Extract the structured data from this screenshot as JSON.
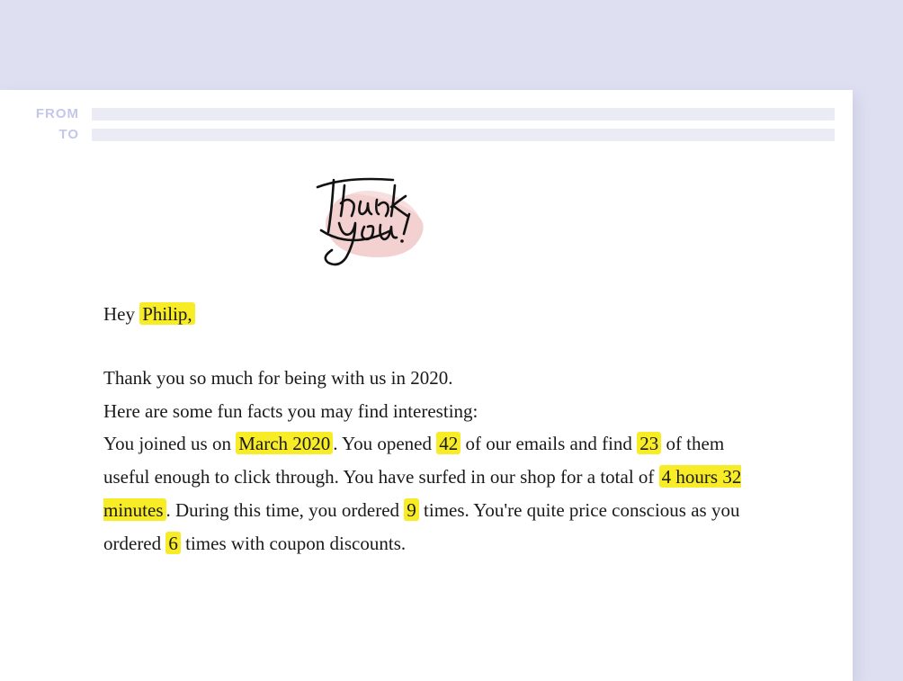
{
  "header": {
    "from_label": "FROM",
    "to_label": "TO"
  },
  "logo": {
    "name": "Thank You!"
  },
  "email": {
    "greeting_prefix": "Hey ",
    "recipient_name": "Philip,",
    "line1": "Thank you so much for being with us in 2020.",
    "line2": "Here are some fun facts you may find interesting:",
    "seg_you_joined": "You joined us on ",
    "hl_join_date": "March 2020",
    "seg_you_opened": ". You opened ",
    "hl_open_count": "42",
    "seg_of_emails_and_find": " of our emails and find ",
    "hl_useful_count": "23",
    "seg_useful_click": " of them useful enough to click through. You have surfed in our shop for a total of ",
    "hl_duration": "4 hours 32 minutes",
    "seg_during_time_ordered": ". During this time, you ordered ",
    "hl_order_count": "9",
    "seg_price_conscious": " times. You're quite price conscious as you ordered ",
    "hl_coupon_count": "6",
    "seg_coupon_tail": " times with coupon discounts."
  }
}
